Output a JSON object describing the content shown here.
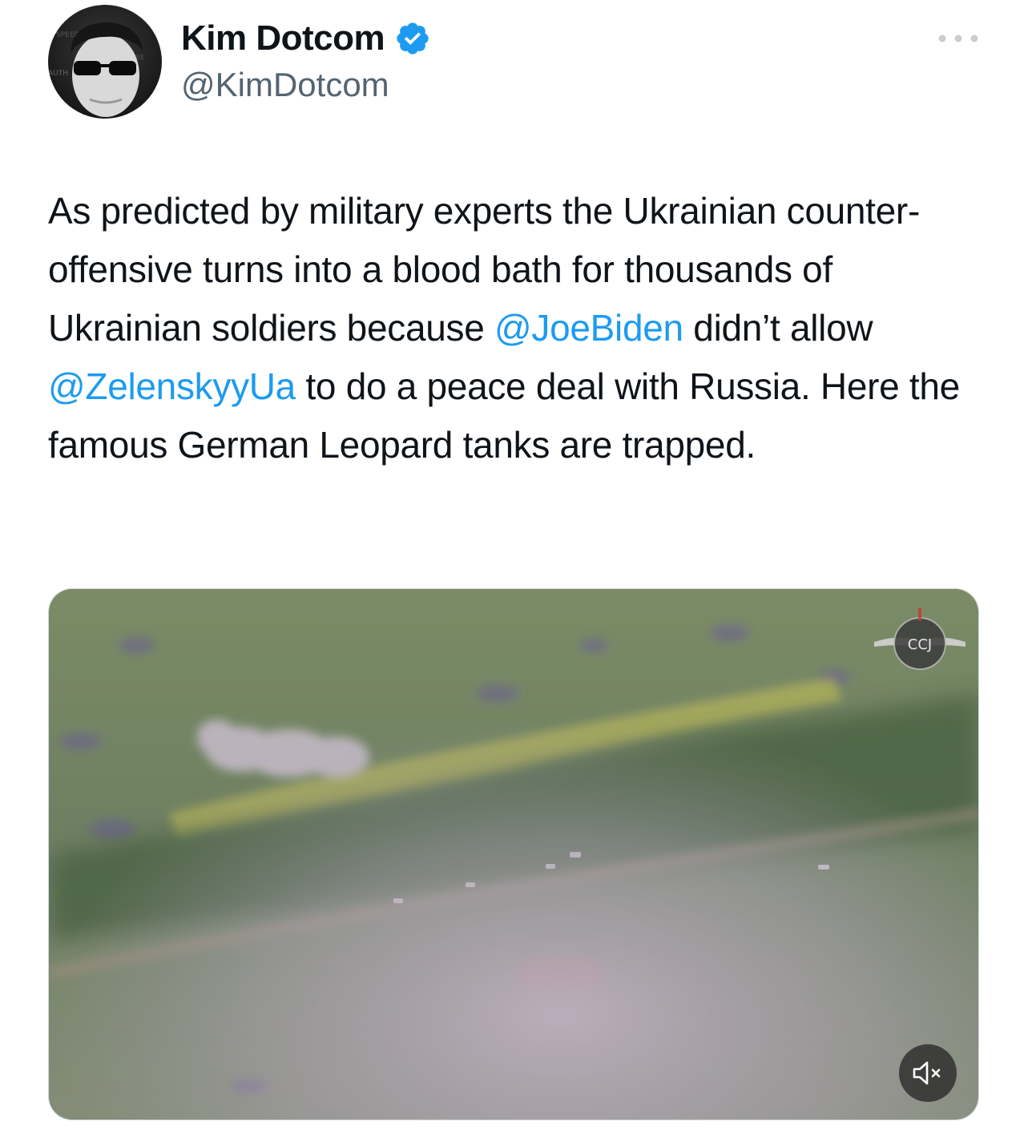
{
  "author": {
    "display_name": "Kim Dotcom",
    "handle": "@KimDotcom",
    "verified": true,
    "avatar_icon": "profile-photo"
  },
  "tweet": {
    "text_before_mention_1": "As predicted by military experts the Ukrainian counter-offensive turns into a blood bath for thousands of Ukrainian soldiers because ",
    "mention_1": "@JoeBiden",
    "text_between_mentions": " didn’t allow ",
    "mention_2": "@ZelenskyyUa",
    "text_after_mention_2": " to do a peace deal with Russia. Here the famous German Leopard tanks are trapped."
  },
  "media": {
    "type": "video",
    "overlay_logo_text": "CCJ",
    "mute_icon": "speaker-muted-icon"
  },
  "icons": {
    "more": "more-dots-icon",
    "verified": "verified-badge-icon"
  },
  "colors": {
    "accent": "#1d9bf0",
    "text_primary": "#0f1419",
    "text_secondary": "#536471"
  }
}
